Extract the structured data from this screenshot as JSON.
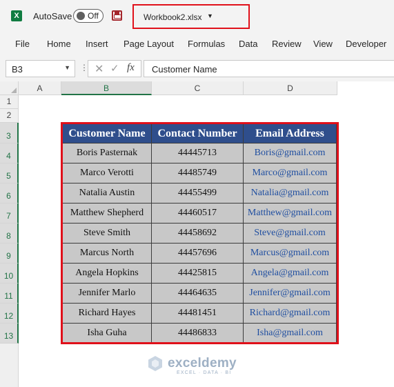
{
  "titlebar": {
    "autosave_label": "AutoSave",
    "autosave_state": "Off",
    "filename": "Workbook2.xlsx"
  },
  "ribbon": {
    "tabs": [
      "File",
      "Home",
      "Insert",
      "Page Layout",
      "Formulas",
      "Data",
      "Review",
      "View",
      "Developer"
    ]
  },
  "formula_bar": {
    "name_box": "B3",
    "fx": "fx",
    "value": "Customer Name"
  },
  "columns": [
    "A",
    "B",
    "C",
    "D"
  ],
  "rows": [
    "1",
    "2",
    "3",
    "4",
    "5",
    "6",
    "7",
    "8",
    "9",
    "10",
    "11",
    "12",
    "13"
  ],
  "table": {
    "headers": [
      "Customer Name",
      "Contact Number",
      "Email Address"
    ],
    "rows": [
      [
        "Boris Pasternak",
        "44445713",
        "Boris@gmail.com"
      ],
      [
        "Marco Verotti",
        "44485749",
        "Marco@gmail.com"
      ],
      [
        "Natalia Austin",
        "44455499",
        "Natalia@gmail.com"
      ],
      [
        "Matthew Shepherd",
        "44460517",
        "Matthew@gmail.com"
      ],
      [
        "Steve Smith",
        "44458692",
        "Steve@gmail.com"
      ],
      [
        "Marcus North",
        "44457696",
        "Marcus@gmail.com"
      ],
      [
        "Angela Hopkins",
        "44425815",
        "Angela@gmail.com"
      ],
      [
        "Jennifer Marlo",
        "44464635",
        "Jennifer@gmail.com"
      ],
      [
        "Richard Hayes",
        "44481451",
        "Richard@gmail.com"
      ],
      [
        "Isha Guha",
        "44486833",
        "Isha@gmail.com"
      ]
    ]
  },
  "watermark": {
    "name": "exceldemy",
    "tagline": "EXCEL · DATA · BI"
  },
  "colors": {
    "header_fill": "#2f4e8c",
    "cell_fill": "#c8c8c8",
    "highlight_border": "#e0101a",
    "excel_green": "#217346",
    "link": "#1f4ea0"
  }
}
